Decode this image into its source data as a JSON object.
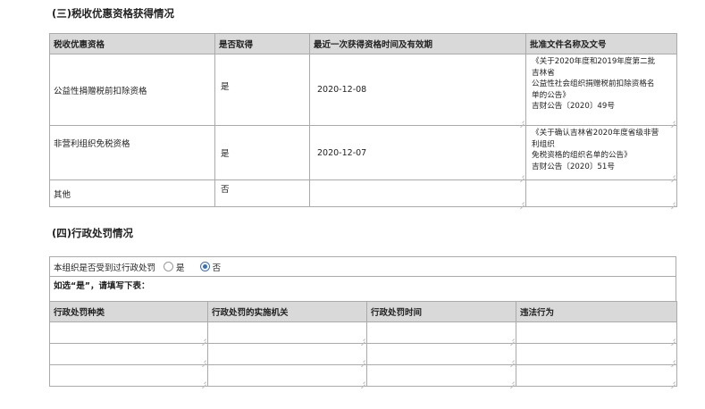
{
  "section3": {
    "title": "(三)税收优惠资格获得情况",
    "headers": [
      "税收优惠资格",
      "是否取得",
      "最近一次获得资格时间及有效期",
      "批准文件名称及文号"
    ],
    "rows": [
      {
        "name": "公益性捐赠税前扣除资格",
        "obtained": "是",
        "date": "2020-12-08",
        "doc": "《关于2020年度和2019年度第二批\n吉林省\n公益性社会组织捐赠税前扣除资格名\n单的公告》\n吉财公告〔2020〕49号"
      },
      {
        "name": "非营利组织免税资格",
        "obtained": "是",
        "date": "2020-12-07",
        "doc": "《关于确认吉林省2020年度省级非营\n利组织\n免税资格的组织名单的公告》\n 吉财公告〔2020〕51号"
      },
      {
        "name": "其他",
        "obtained": "否",
        "date": "",
        "doc": ""
      }
    ]
  },
  "section4": {
    "title": "(四)行政处罚情况",
    "question": "本组织是否受到过行政处罚",
    "option_yes": "是",
    "option_no": "否",
    "selected": "否",
    "note": "如选“是”，请填写下表：",
    "headers": [
      "行政处罚种类",
      "行政处罚的实施机关",
      "行政处罚时间",
      "违法行为"
    ],
    "empty_rows": 3
  },
  "colors": {
    "header_bg": "#d9d9d9",
    "radio_accent": "#3a6fc2"
  }
}
